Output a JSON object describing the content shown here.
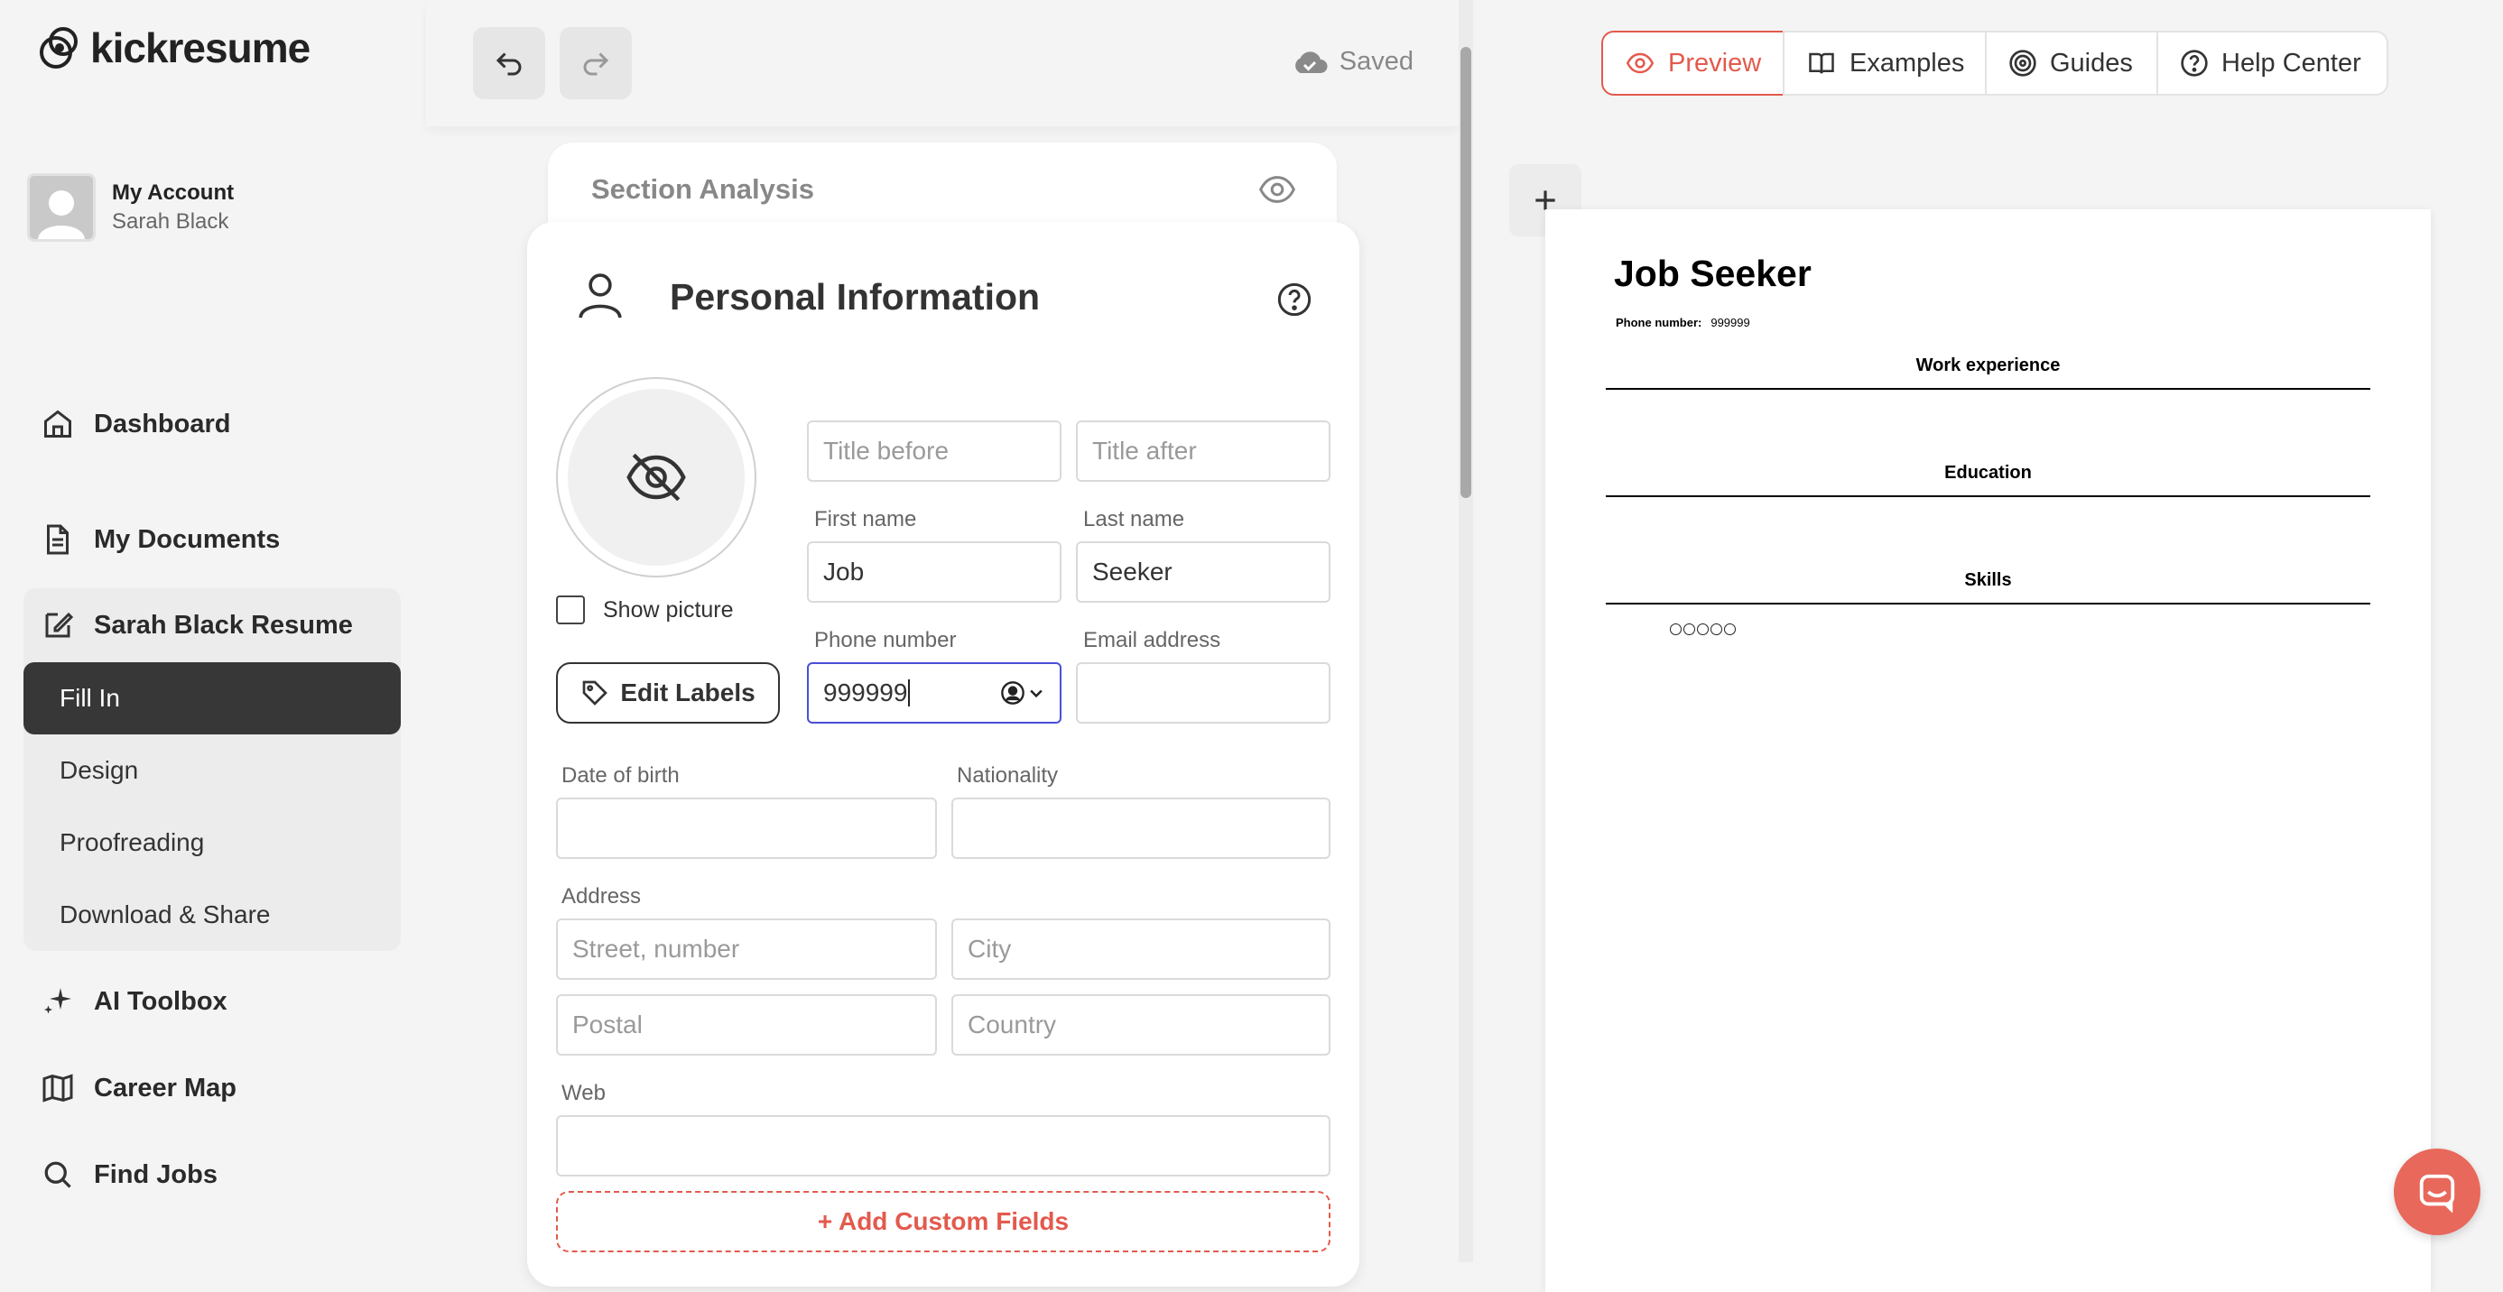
{
  "brand": {
    "name": "kickresume"
  },
  "account": {
    "title": "My Account",
    "name": "Sarah Black"
  },
  "nav": {
    "dashboard": "Dashboard",
    "documents": "My Documents",
    "resume": "Sarah Black Resume",
    "sub_items": [
      "Fill In",
      "Design",
      "Proofreading",
      "Download & Share"
    ],
    "ai_toolbox": "AI Toolbox",
    "career_map": "Career Map",
    "find_jobs": "Find Jobs"
  },
  "toolbar": {
    "saved": "Saved"
  },
  "section_analysis": {
    "label": "Section Analysis"
  },
  "personal_info": {
    "title": "Personal Information",
    "show_picture": "Show picture",
    "edit_labels": "Edit Labels",
    "title_before_placeholder": "Title before",
    "title_after_placeholder": "Title after",
    "first_name_label": "First name",
    "first_name_value": "Job",
    "last_name_label": "Last name",
    "last_name_value": "Seeker",
    "phone_label": "Phone number",
    "phone_value": "999999",
    "email_label": "Email address",
    "email_value": "",
    "dob_label": "Date of birth",
    "dob_value": "",
    "nationality_label": "Nationality",
    "nationality_value": "",
    "address_label": "Address",
    "street_placeholder": "Street, number",
    "city_placeholder": "City",
    "postal_placeholder": "Postal",
    "country_placeholder": "Country",
    "web_label": "Web",
    "web_value": "",
    "add_custom": "+ Add Custom Fields"
  },
  "preview_tabs": {
    "preview": "Preview",
    "examples": "Examples",
    "guides": "Guides",
    "help": "Help Center"
  },
  "doc": {
    "name": "Job Seeker",
    "phone_label": "Phone number:",
    "phone_value": "999999",
    "sections": [
      "Work experience",
      "Education",
      "Skills"
    ]
  },
  "colors": {
    "accent": "#e35a4d",
    "active_nav": "#373737",
    "focus": "#4a4fd8"
  },
  "icons": [
    "undo-icon",
    "redo-icon",
    "cloud-check-icon",
    "eye-icon",
    "home-icon",
    "document-icon",
    "edit-icon",
    "sparkle-icon",
    "map-icon",
    "search-icon",
    "person-icon",
    "help-icon",
    "eye-off-icon",
    "tag-icon",
    "book-icon",
    "target-icon",
    "plus-icon",
    "chat-icon"
  ]
}
